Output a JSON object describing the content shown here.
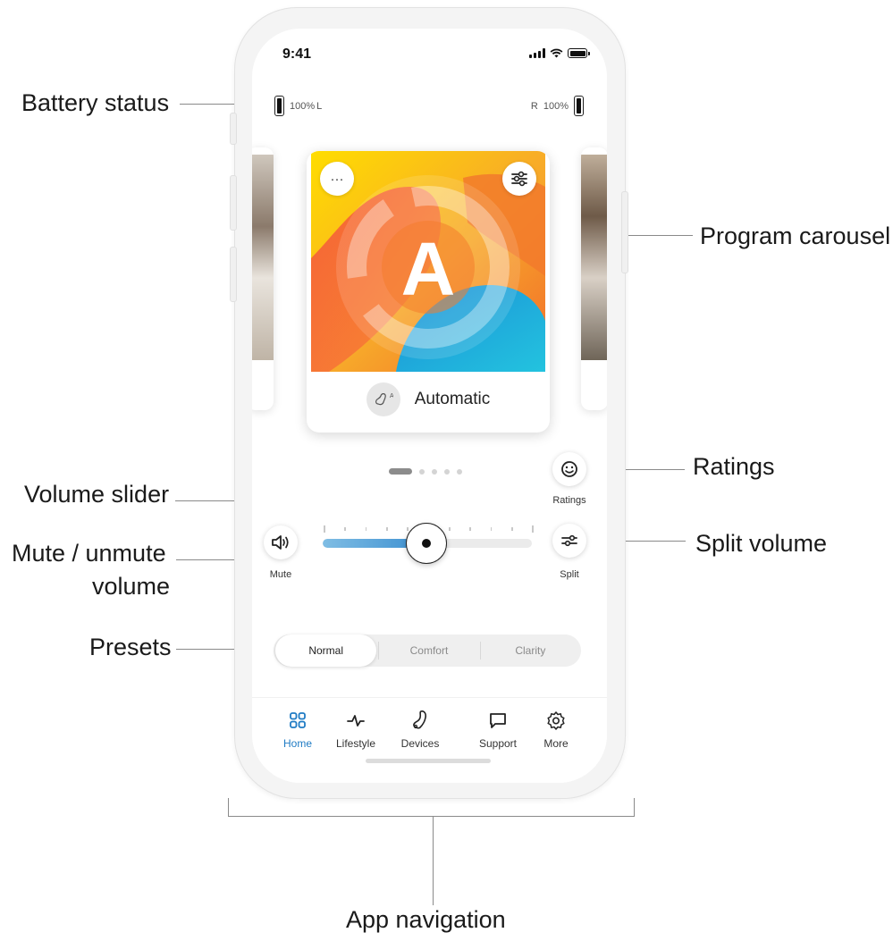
{
  "callouts": {
    "battery_status": "Battery status",
    "program_carousel": "Program carousel",
    "ratings": "Ratings",
    "volume_slider": "Volume slider",
    "mute_line1": "Mute / unmute",
    "mute_line2": "volume",
    "split_volume": "Split volume",
    "presets": "Presets",
    "app_navigation": "App navigation"
  },
  "status_bar": {
    "time": "9:41"
  },
  "hearing_aid_battery": {
    "left": {
      "level_text": "100%",
      "side": "L",
      "level": 1.0
    },
    "right": {
      "side": "R",
      "level_text": "100%",
      "level": 1.0
    }
  },
  "program": {
    "letter": "A",
    "name": "Automatic",
    "more_glyph": "···",
    "icon_letter": "A"
  },
  "carousel": {
    "page_count": 5,
    "active_index": 0
  },
  "controls": {
    "ratings_label": "Ratings",
    "mute_label": "Mute",
    "split_label": "Split"
  },
  "volume": {
    "level": 0.5
  },
  "presets": {
    "items": [
      "Normal",
      "Comfort",
      "Clarity"
    ],
    "selected": "Normal"
  },
  "tabbar": {
    "items": [
      {
        "label": "Home",
        "icon": "grid-icon",
        "active": true
      },
      {
        "label": "Lifestyle",
        "icon": "activity-icon",
        "active": false
      },
      {
        "label": "Devices",
        "icon": "hearing-aid-icon",
        "active": false
      },
      {
        "label": "Support",
        "icon": "chat-icon",
        "active": false
      },
      {
        "label": "More",
        "icon": "gear-icon",
        "active": false
      }
    ]
  },
  "colors": {
    "accent": "#1f7bc4",
    "slider_fill": "#3c8fd0",
    "art_yellow": "#ffd400",
    "art_orange": "#f47c2c",
    "art_blue": "#2ba6d8"
  }
}
